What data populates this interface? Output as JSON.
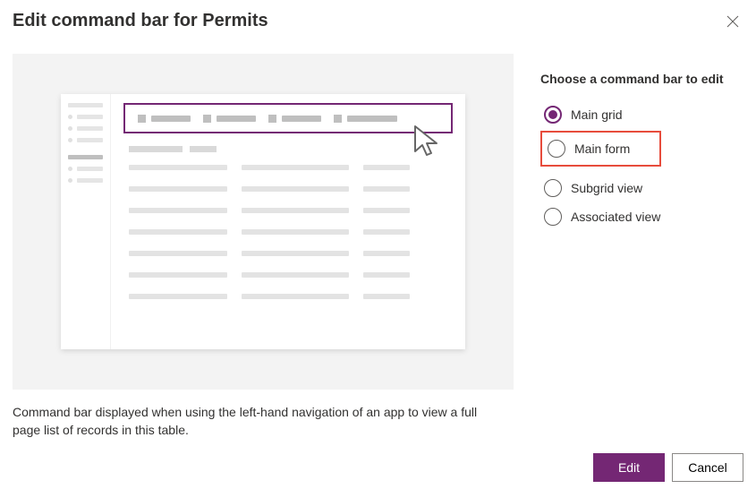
{
  "dialog": {
    "title": "Edit command bar for Permits",
    "description": "Command bar displayed when using the left-hand navigation of an app to view a full page list of records in this table."
  },
  "options": {
    "heading": "Choose a command bar to edit",
    "items": [
      {
        "label": "Main grid",
        "selected": true,
        "highlighted": false
      },
      {
        "label": "Main form",
        "selected": false,
        "highlighted": true
      },
      {
        "label": "Subgrid view",
        "selected": false,
        "highlighted": false
      },
      {
        "label": "Associated view",
        "selected": false,
        "highlighted": false
      }
    ]
  },
  "footer": {
    "primary": "Edit",
    "secondary": "Cancel"
  },
  "icons": {
    "close": "close-icon",
    "cursor": "cursor-icon"
  }
}
